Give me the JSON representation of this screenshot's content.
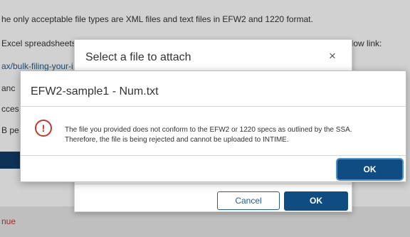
{
  "background": {
    "lines": [
      "he only acceptable file types are XML files and text files in EFW2 and 1220 format.",
      "Excel spreadsheets",
      "ax/bulk-filing-your-i",
      "anc",
      "cces",
      "B pe"
    ],
    "right_fragment": "elow link:",
    "continue_label": "nue"
  },
  "select_dialog": {
    "title": "Select a file to attach",
    "close_glyph": "×",
    "cancel_label": "Cancel",
    "ok_label": "OK"
  },
  "error_dialog": {
    "title": "EFW2-sample1 - Num.txt",
    "icon_glyph": "!",
    "message_line1": "The file you provided does not conform to the EFW2 or 1220 specs as outlined by the SSA.",
    "message_line2": "Therefore, the file is being rejected and cannot be uploaded to INTIME.",
    "ok_label": "OK"
  },
  "colors": {
    "primary": "#0f4c81",
    "error": "#c0392b",
    "link": "#1f5d94"
  }
}
